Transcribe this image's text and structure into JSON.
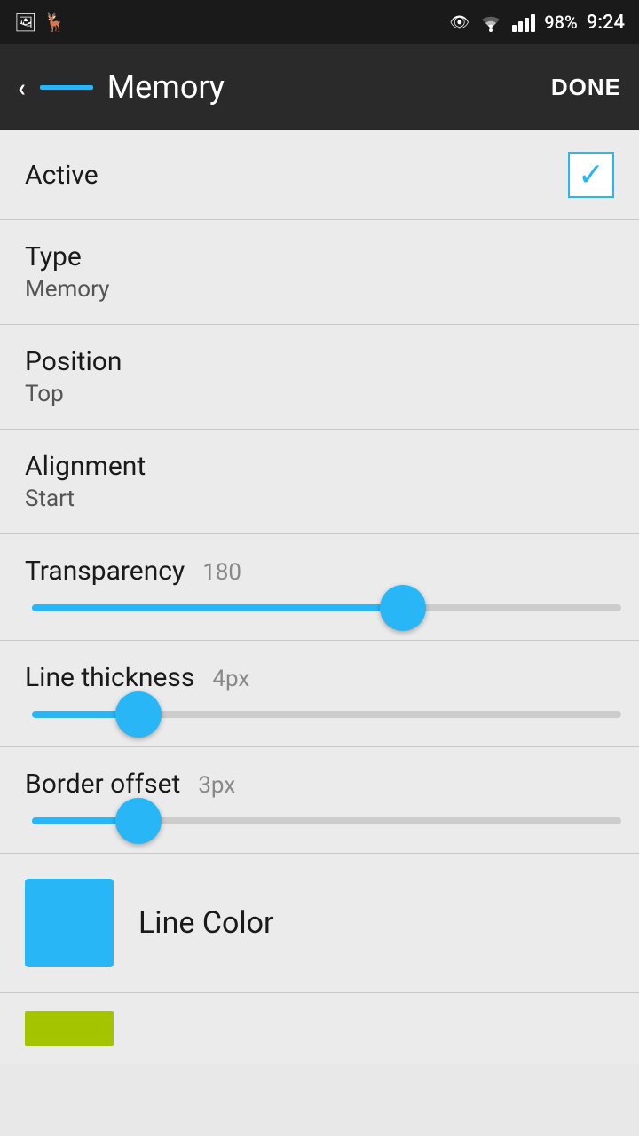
{
  "statusBar": {
    "battery": "98%",
    "time": "9:24"
  },
  "toolbar": {
    "title": "Memory",
    "doneLabel": "DONE"
  },
  "rows": [
    {
      "id": "active",
      "label": "Active",
      "type": "checkbox",
      "checked": true
    },
    {
      "id": "type",
      "label": "Type",
      "value": "Memory"
    },
    {
      "id": "position",
      "label": "Position",
      "value": "Top"
    },
    {
      "id": "alignment",
      "label": "Alignment",
      "value": "Start"
    }
  ],
  "sliders": [
    {
      "id": "transparency",
      "label": "Transparency",
      "value": "180",
      "fillPercent": 63
    },
    {
      "id": "line-thickness",
      "label": "Line thickness",
      "value": "4px",
      "fillPercent": 18
    },
    {
      "id": "border-offset",
      "label": "Border offset",
      "value": "3px",
      "fillPercent": 18
    }
  ],
  "colorSection": {
    "label": "Line Color",
    "swatchColor": "#29b6f6",
    "bottomSwatchColor": "#a4c400"
  }
}
